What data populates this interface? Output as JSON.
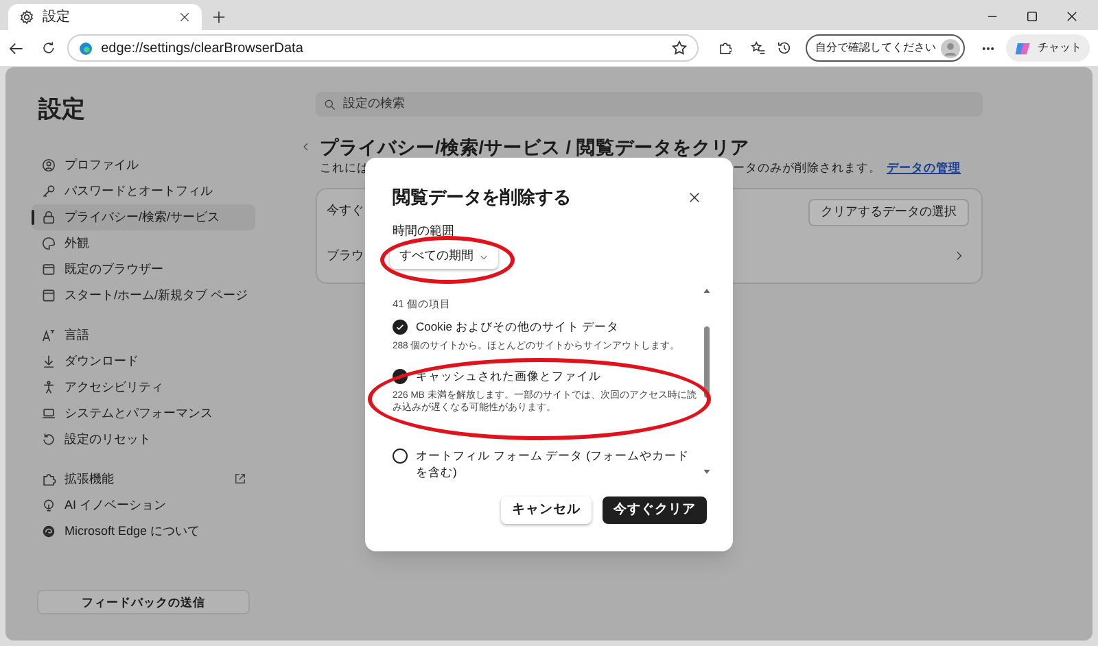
{
  "browser": {
    "tab": {
      "title": "設定"
    },
    "address": "edge://settings/clearBrowserData",
    "profile_label": "自分で確認してください",
    "chat_label": "チャット"
  },
  "sidebar": {
    "title": "設定",
    "groups": [
      [
        {
          "label": "プロファイル",
          "selected": false,
          "external": false
        },
        {
          "label": "パスワードとオートフィル",
          "selected": false,
          "external": false
        },
        {
          "label": "プライバシー/検索/サービス",
          "selected": true,
          "external": false
        },
        {
          "label": "外観",
          "selected": false,
          "external": false
        },
        {
          "label": "既定のブラウザー",
          "selected": false,
          "external": false
        },
        {
          "label": "スタート/ホーム/新規タブ ページ",
          "selected": false,
          "external": false
        }
      ],
      [
        {
          "label": "言語",
          "selected": false,
          "external": false
        },
        {
          "label": "ダウンロード",
          "selected": false,
          "external": false
        },
        {
          "label": "アクセシビリティ",
          "selected": false,
          "external": false
        },
        {
          "label": "システムとパフォーマンス",
          "selected": false,
          "external": false
        },
        {
          "label": "設定のリセット",
          "selected": false,
          "external": false
        }
      ],
      [
        {
          "label": "拡張機能",
          "selected": false,
          "external": true
        },
        {
          "label": "AI イノベーション",
          "selected": false,
          "external": false
        },
        {
          "label": "Microsoft Edge について",
          "selected": false,
          "external": false
        }
      ]
    ],
    "feedback_button": "フィードバックの送信"
  },
  "main": {
    "search_placeholder": "設定の検索",
    "title": "プライバシー/検索/サービス / 閲覧データをクリア",
    "description_start": "これには",
    "description_end": "ータのみが削除されます。",
    "manage_link": "データの管理",
    "card_rows": [
      {
        "label": "今すぐ",
        "button": "クリアするデータの選択"
      },
      {
        "label": "ブラウ"
      }
    ]
  },
  "dialog": {
    "title": "閲覧データを削除する",
    "range_label": "時間の範囲",
    "range_value": "すべての期間",
    "item_count": "41 個の項目",
    "items": [
      {
        "label": "Cookie およびその他のサイト データ",
        "description": "288 個のサイトから。ほとんどのサイトからサインアウトします。",
        "checked": true
      },
      {
        "label": "キャッシュされた画像とファイル",
        "description": "226 MB 未満を解放します。一部のサイトでは、次回のアクセス時に読み込みが遅くなる可能性があります。",
        "checked": true
      },
      {
        "label": "オートフィル フォーム データ (フォームやカードを含む)",
        "checked": false
      }
    ],
    "buttons": [
      {
        "label": "キャンセル",
        "kind": "secondary"
      },
      {
        "label": "今すぐクリア",
        "kind": "primary"
      }
    ]
  }
}
